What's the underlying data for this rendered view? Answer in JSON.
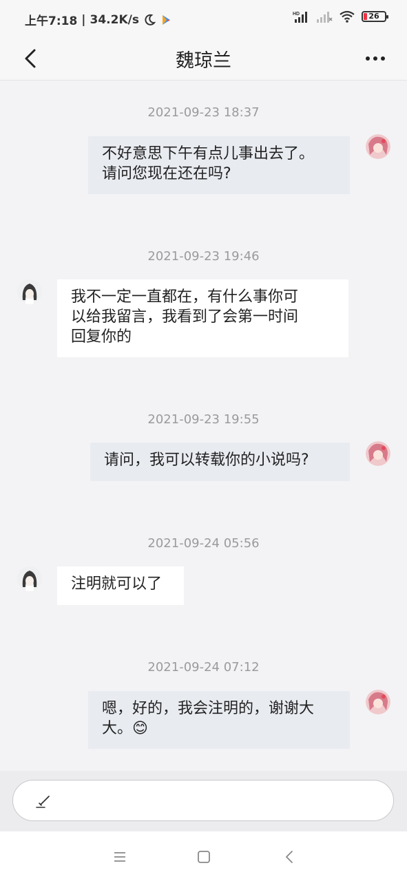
{
  "status_bar": {
    "time": "上午7:18",
    "speed": "34.2K/s",
    "battery": "26",
    "icons": [
      "moon-icon",
      "play-store-icon",
      "hd-signal-icon",
      "signal-empty-icon",
      "wifi-icon",
      "battery-icon"
    ]
  },
  "header": {
    "title": "魏琼兰",
    "back_icon": "chevron-left-icon",
    "more_icon": "more-dots-icon"
  },
  "messages": [
    {
      "timestamp": "2021-09-23 18:37",
      "sender": "self",
      "text": "不好意思下午有点儿事出去了。\n请问您现在还在吗?"
    },
    {
      "timestamp": "2021-09-23 19:46",
      "sender": "other",
      "text": "我不一定一直都在，有什么事你可\n以给我留言，我看到了会第一时间\n回复你的"
    },
    {
      "timestamp": "2021-09-23 19:55",
      "sender": "self",
      "text": "请问，我可以转载你的小说吗?"
    },
    {
      "timestamp": "2021-09-24 05:56",
      "sender": "other",
      "text": "注明就可以了"
    },
    {
      "timestamp": "2021-09-24 07:12",
      "sender": "self",
      "text": "嗯，好的，我会注明的，谢谢大\n大。😊"
    }
  ],
  "input": {
    "placeholder": "",
    "icon": "pen-icon"
  },
  "nav": {
    "icons": [
      "menu-icon",
      "home-icon",
      "back-icon"
    ]
  },
  "colors": {
    "self_bubble": "#e8ebf0",
    "other_bubble": "#ffffff",
    "background": "#f3f3f5",
    "timestamp": "#9a9a9f"
  }
}
